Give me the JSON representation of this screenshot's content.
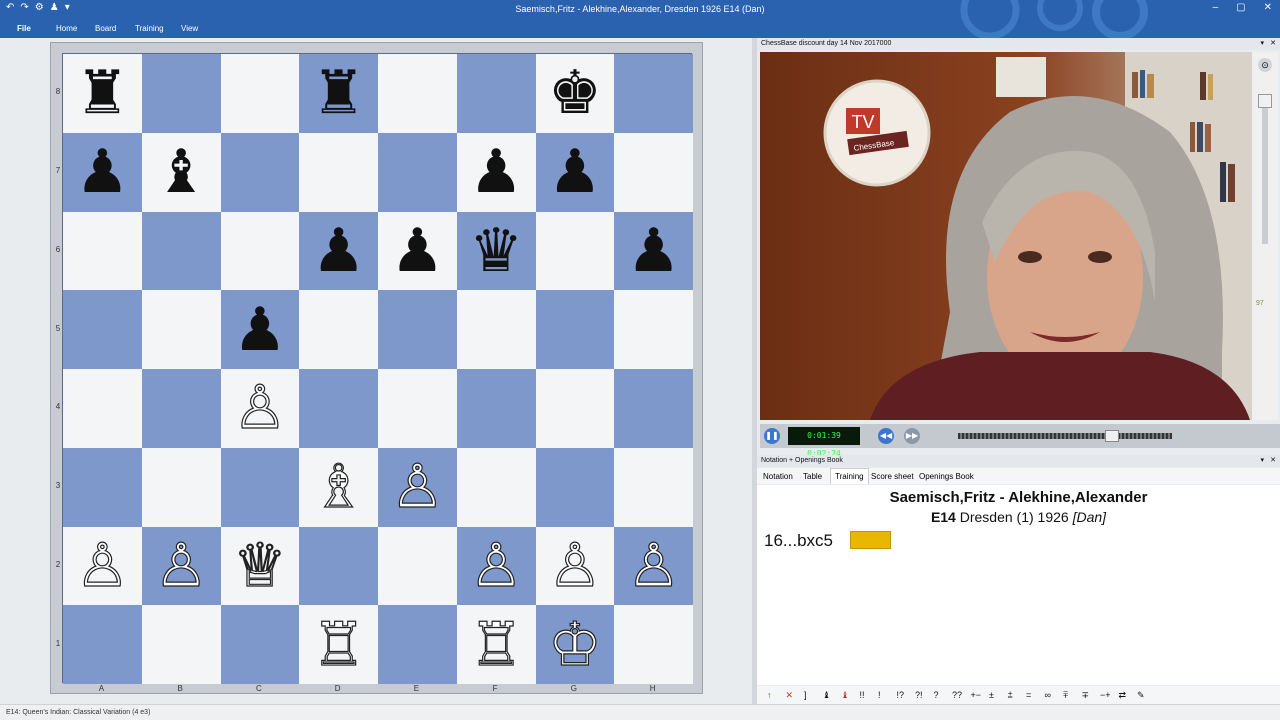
{
  "window": {
    "title": "Saemisch,Fritz - Alekhine,Alexander, Dresden 1926  E14  (Dan)",
    "controls": [
      "–",
      "▢",
      "✕"
    ]
  },
  "ribbon": {
    "tabs": [
      "File",
      "Home",
      "Board",
      "Training",
      "View"
    ]
  },
  "board": {
    "ranks": [
      "8",
      "7",
      "6",
      "5",
      "4",
      "3",
      "2",
      "1"
    ],
    "files": [
      "A",
      "B",
      "C",
      "D",
      "E",
      "F",
      "G",
      "H"
    ],
    "pieces": [
      {
        "sq": "a8",
        "p": "♜",
        "c": "b"
      },
      {
        "sq": "d8",
        "p": "♜",
        "c": "b"
      },
      {
        "sq": "g8",
        "p": "♚",
        "c": "b"
      },
      {
        "sq": "a7",
        "p": "♟",
        "c": "b"
      },
      {
        "sq": "b7",
        "p": "♝",
        "c": "b"
      },
      {
        "sq": "f7",
        "p": "♟",
        "c": "b"
      },
      {
        "sq": "g7",
        "p": "♟",
        "c": "b"
      },
      {
        "sq": "d6",
        "p": "♟",
        "c": "b"
      },
      {
        "sq": "e6",
        "p": "♟",
        "c": "b"
      },
      {
        "sq": "f6",
        "p": "♛",
        "c": "b"
      },
      {
        "sq": "h6",
        "p": "♟",
        "c": "b"
      },
      {
        "sq": "c5",
        "p": "♟",
        "c": "b"
      },
      {
        "sq": "c4",
        "p": "♙",
        "c": "w"
      },
      {
        "sq": "d3",
        "p": "♗",
        "c": "w"
      },
      {
        "sq": "e3",
        "p": "♙",
        "c": "w"
      },
      {
        "sq": "a2",
        "p": "♙",
        "c": "w"
      },
      {
        "sq": "b2",
        "p": "♙",
        "c": "w"
      },
      {
        "sq": "c2",
        "p": "♕",
        "c": "w"
      },
      {
        "sq": "f2",
        "p": "♙",
        "c": "w"
      },
      {
        "sq": "g2",
        "p": "♙",
        "c": "w"
      },
      {
        "sq": "h2",
        "p": "♙",
        "c": "w"
      },
      {
        "sq": "d1",
        "p": "♖",
        "c": "w"
      },
      {
        "sq": "f1",
        "p": "♖",
        "c": "w"
      },
      {
        "sq": "g1",
        "p": "♔",
        "c": "w"
      }
    ]
  },
  "video": {
    "panel_title": "ChessBase discount day 14 Nov 2017000",
    "logo_top": "TV",
    "logo_bottom": "ChessBase",
    "time": "0:01:39 0:02:24",
    "side_number": "97",
    "progress": 0.72
  },
  "notation": {
    "panel_title": "Notation + Openings Book",
    "tabs": [
      "Notation",
      "Table",
      "Training",
      "Score sheet",
      "Openings Book"
    ],
    "active_tab": "Training",
    "players": "Saemisch,Fritz - Alekhine,Alexander",
    "eco": "E14",
    "event": "Dresden (1) 1926",
    "annotator": "[Dan]",
    "move": "16...bxc5",
    "tools": [
      "↑",
      "✕",
      "]",
      "♝",
      "♝",
      "!!",
      "!",
      "!?",
      "?!",
      "?",
      "??",
      "+−",
      "±",
      "⩲",
      "=",
      "∞",
      "⩱",
      "∓",
      "−+",
      "⇄",
      "✎"
    ]
  },
  "status": {
    "text": "E14: Queen's Indian: Classical Variation (4 e3)"
  },
  "colors": {
    "accent": "#2a62b0",
    "dark_square": "#7e98cc",
    "light_square": "#f4f5f7",
    "move_marker": "#e9b600"
  }
}
